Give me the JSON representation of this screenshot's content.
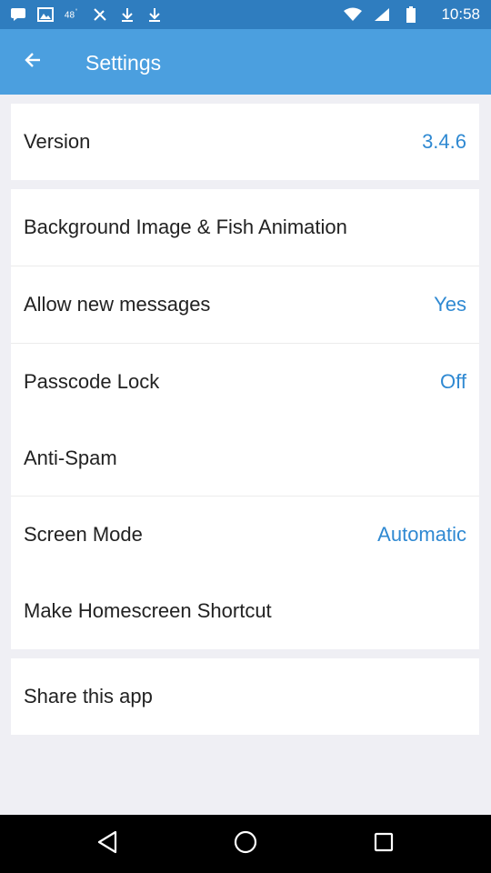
{
  "status_bar": {
    "time": "10:58",
    "left_icons": [
      "message-icon",
      "image-icon",
      "signal-48-icon",
      "tools-icon",
      "download-icon",
      "download-icon"
    ],
    "right_icons": [
      "wifi-icon",
      "cellular-icon",
      "battery-icon"
    ]
  },
  "app_bar": {
    "title": "Settings"
  },
  "version": {
    "label": "Version",
    "value": "3.4.6"
  },
  "settings": {
    "background": {
      "label": "Background Image & Fish Animation"
    },
    "messages": {
      "label": "Allow new messages",
      "value": "Yes"
    },
    "passcode": {
      "label": "Passcode Lock",
      "value": "Off"
    },
    "antispam": {
      "label": "Anti-Spam"
    },
    "screen_mode": {
      "label": "Screen Mode",
      "value": "Automatic"
    },
    "shortcut": {
      "label": "Make Homescreen Shortcut"
    }
  },
  "share": {
    "label": "Share this app"
  },
  "colors": {
    "app_bar": "#4b9fdf",
    "status_bar": "#2f7dbf",
    "accent": "#2f89d2",
    "background": "#efeff4"
  }
}
